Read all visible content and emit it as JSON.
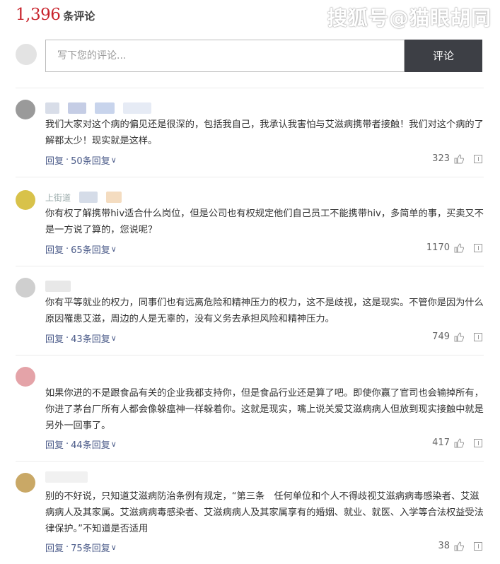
{
  "header": {
    "count": "1,396",
    "count_label": "条评论",
    "watermark": "搜狐号@猫眼胡同"
  },
  "compose": {
    "placeholder": "写下您的评论...",
    "submit_label": "评论"
  },
  "comments": [
    {
      "avatar_color": "#9a9a9a",
      "text": "我们大家对这个病的偏见还是很深的，包括我自己，我承认我害怕与艾滋病携带者接触！我们对这个病的了解都太少！现实就是这样。",
      "reply": "回复",
      "replies": "50条回复",
      "likes": "323"
    },
    {
      "avatar_color": "#d8c24a",
      "user": "上街道",
      "text": "你有权了解携带hiv适合什么岗位，但是公司也有权规定他们自己员工不能携带hiv，多简单的事，买卖又不是一方说了算的，您说呢？",
      "reply": "回复",
      "replies": "65条回复",
      "likes": "1170"
    },
    {
      "avatar_color": "#cfcfcf",
      "text": "你有平等就业的权力，同事们也有远离危险和精神压力的权力，这不是歧视，这是现实。不管你是因为什么原因罹患艾滋，周边的人是无辜的，没有义务去承担风险和精神压力。",
      "reply": "回复",
      "replies": "43条回复",
      "likes": "749"
    },
    {
      "avatar_color": "#e4a3a8",
      "text": "如果你进的不是跟食品有关的企业我都支持你，但是食品行业还是算了吧。即使你赢了官司也会输掉所有，你进了茅台厂所有人都会像躲瘟神一样躲着你。这就是现实，嘴上说关爱艾滋病病人但放到现实接触中就是另外一回事了。",
      "reply": "回复",
      "replies": "44条回复",
      "likes": "417"
    },
    {
      "avatar_color": "#c9a866",
      "text": "别的不好说，只知道艾滋病防治条例有规定，“第三条　任何单位和个人不得歧视艾滋病病毒感染者、艾滋病病人及其家属。艾滋病病毒感染者、艾滋病病人及其家属享有的婚姻、就业、就医、入学等合法权益受法律保护。”不知道是否适用",
      "reply": "回复",
      "replies": "75条回复",
      "likes": "38"
    }
  ]
}
